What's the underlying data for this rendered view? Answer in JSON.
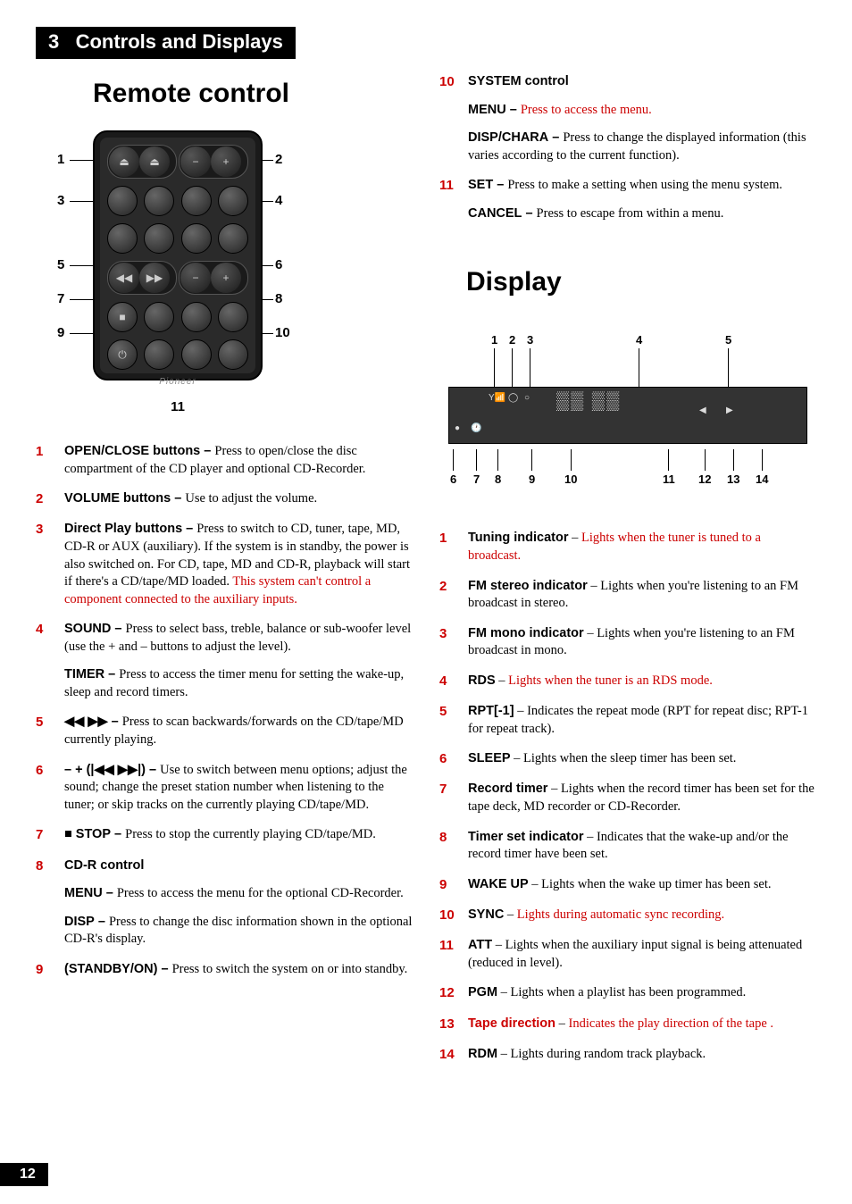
{
  "chapter": {
    "number": "3",
    "title": "Controls and Displays"
  },
  "page_number": "12",
  "remote": {
    "title": "Remote control",
    "callouts": [
      "1",
      "2",
      "3",
      "4",
      "5",
      "6",
      "7",
      "8",
      "9",
      "10",
      "11"
    ],
    "logo": "Pioneer",
    "items": [
      {
        "n": "1",
        "term": "OPEN/CLOSE buttons",
        "sep": " – ",
        "text": "Press to open/close the disc compartment of the CD player and optional CD-Recorder."
      },
      {
        "n": "2",
        "term": "VOLUME buttons",
        "sep": " – ",
        "text": "Use to adjust the volume."
      },
      {
        "n": "3",
        "term": "Direct Play buttons",
        "sep": " – ",
        "text": "Press to switch to CD, tuner, tape, MD, CD-R or AUX (auxiliary). If the system is in standby, the power is also switched on. For CD, tape, MD and CD-R, playback will start if there's a CD/tape/MD loaded. ",
        "red_suffix": "This system can't control a component connected to the auxiliary inputs."
      },
      {
        "n": "4",
        "term": "SOUND",
        "sep": " – ",
        "text": "Press to select bass, treble, balance or sub-woofer level (use the + and – buttons to adjust the level).",
        "sub": {
          "term": "TIMER",
          "sep": " – ",
          "text": "Press to access the timer menu for setting the wake-up, sleep and record timers."
        }
      },
      {
        "n": "5",
        "term_sym": "◀◀  ▶▶",
        "sep": " – ",
        "text": "Press to scan backwards/forwards on the CD/tape/MD currently playing."
      },
      {
        "n": "6",
        "term_sym": "– + (|◀◀  ▶▶|)",
        "sep": " – ",
        "text": "Use to switch between menu options; adjust the sound; change the preset station number when listening to the tuner; or skip tracks on the currently playing CD/tape/MD."
      },
      {
        "n": "7",
        "term_sym": "■ STOP",
        "sep": " – ",
        "text": "Press to stop the currently playing CD/tape/MD."
      },
      {
        "n": "8",
        "term": "CD-R control",
        "sep": "",
        "text": "",
        "subs": [
          {
            "term": "MENU",
            "sep": " – ",
            "text": "Press to access the menu for the optional CD-Recorder."
          },
          {
            "term": "DISP",
            "sep": " – ",
            "text": "Press to change the disc information shown in the optional CD-R's display."
          }
        ]
      },
      {
        "n": "9",
        "term_sym": "(STANDBY/ON)",
        "sep": " – ",
        "text": "Press to switch the system on or into standby."
      },
      {
        "n": "10",
        "term": "SYSTEM control",
        "sep": "",
        "text": "",
        "subs": [
          {
            "term": "MENU",
            "sep": " – ",
            "red_text": "Press to access the menu."
          },
          {
            "term": "DISP/CHARA",
            "sep": " – ",
            "text": "Press to change the displayed information (this varies according to the current function)."
          }
        ]
      },
      {
        "n": "11",
        "term": "SET",
        "sep": " – ",
        "text": "Press to make a setting when using the menu system.",
        "sub": {
          "term": "CANCEL",
          "sep": " – ",
          "text": "Press to escape from within a menu."
        }
      }
    ]
  },
  "display": {
    "title": "Display",
    "callouts_top": [
      "1",
      "2",
      "3",
      "4",
      "5"
    ],
    "callouts_bottom": [
      "6",
      "7",
      "8",
      "9",
      "10",
      "11",
      "12",
      "13",
      "14"
    ],
    "items": [
      {
        "n": "1",
        "term": "Tuning indicator",
        "sep": " – ",
        "red_text": "Lights when the tuner is tuned to a broadcast."
      },
      {
        "n": "2",
        "term": "FM stereo indicator",
        "sep": " – ",
        "text": "Lights when you're listening to an FM broadcast in stereo."
      },
      {
        "n": "3",
        "term": "FM mono indicator",
        "sep": " – ",
        "text": "Lights when you're listening to an FM broadcast in mono."
      },
      {
        "n": "4",
        "term": "RDS",
        "sep": " – ",
        "red_text": "Lights when the tuner is an RDS mode."
      },
      {
        "n": "5",
        "term": "RPT[-1]",
        "sep": " – ",
        "text": "Indicates the repeat mode (RPT for repeat disc; RPT-1 for repeat track)."
      },
      {
        "n": "6",
        "term": "SLEEP",
        "sep": " – ",
        "text": "Lights when the sleep timer has been set."
      },
      {
        "n": "7",
        "term": "Record timer",
        "sep": " – ",
        "text": "Lights when the record timer has been set for the tape deck, MD recorder or CD-Recorder."
      },
      {
        "n": "8",
        "term": "Timer set indicator",
        "sep": " – ",
        "text": "Indicates that the wake-up and/or the record timer have been set."
      },
      {
        "n": "9",
        "term": "WAKE UP",
        "sep": " – ",
        "text": "Lights when the wake up timer has been set."
      },
      {
        "n": "10",
        "term": "SYNC",
        "sep": " – ",
        "red_text": "Lights during automatic sync recording."
      },
      {
        "n": "11",
        "term": "ATT",
        "sep": " – ",
        "text": "Lights when the auxiliary input signal is being attenuated (reduced in level)."
      },
      {
        "n": "12",
        "term": "PGM",
        "sep": " – ",
        "text": "Lights when a playlist has been programmed."
      },
      {
        "n": "13",
        "term": "Tape direction",
        "sep": " – ",
        "red_text": "Indicates the play direction of the tape ."
      },
      {
        "n": "14",
        "term": "RDM",
        "sep": " – ",
        "text": "Lights during random track playback."
      }
    ]
  }
}
